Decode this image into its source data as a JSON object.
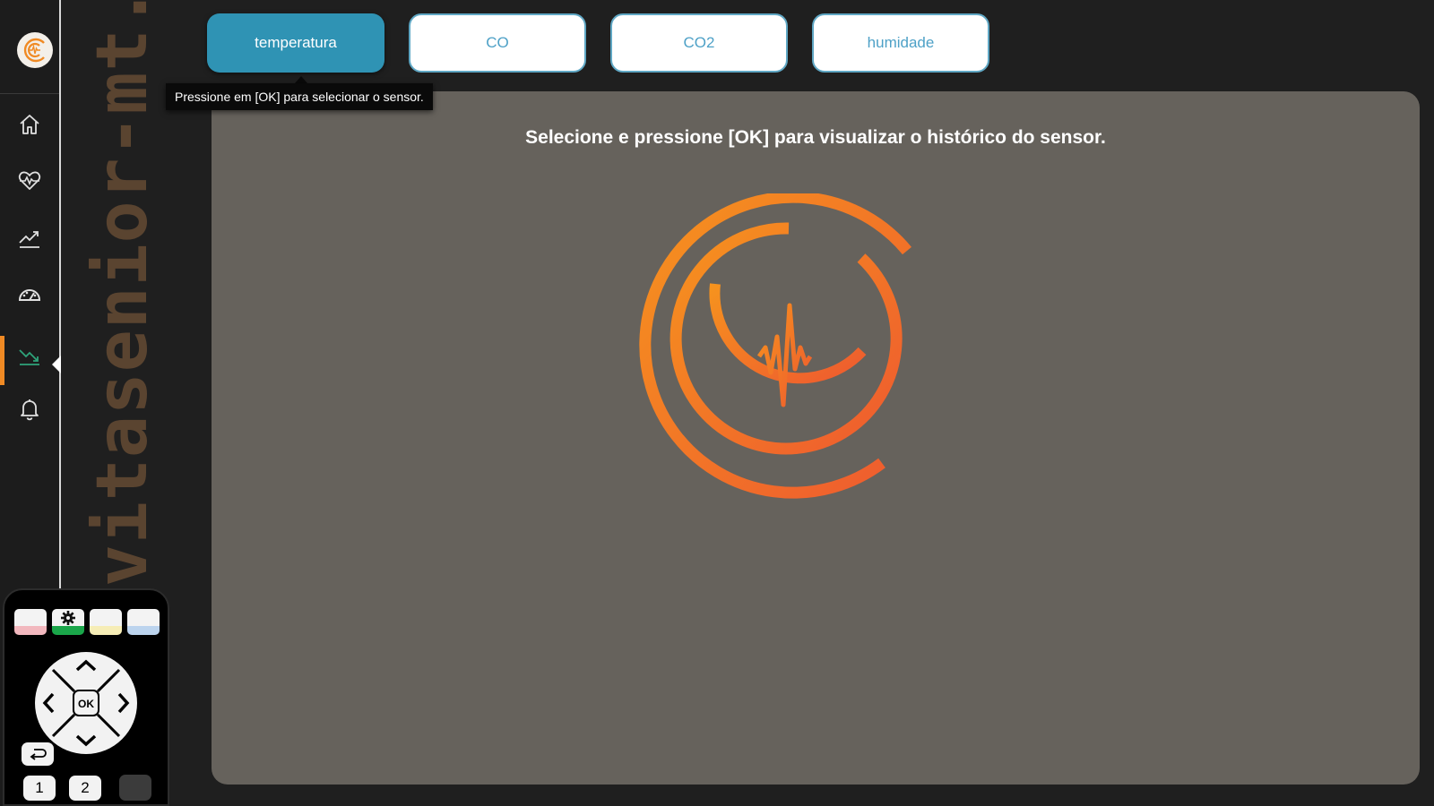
{
  "watermark": "vitasenior-mt.ipt",
  "tabs": [
    {
      "label": "temperatura",
      "active": true
    },
    {
      "label": "CO",
      "active": false
    },
    {
      "label": "CO2",
      "active": false
    },
    {
      "label": "humidade",
      "active": false
    }
  ],
  "tooltip": "Pressione em [OK] para selecionar o sensor.",
  "panel": {
    "message": "Selecione e pressione [OK] para visualizar o histórico do sensor."
  },
  "sidebar": {
    "items": [
      {
        "icon": "home-icon"
      },
      {
        "icon": "heart-monitor-icon"
      },
      {
        "icon": "trending-up-icon"
      },
      {
        "icon": "dashboard-gauge-icon"
      },
      {
        "icon": "trending-down-icon",
        "active": true
      },
      {
        "icon": "bell-icon"
      }
    ]
  },
  "remote": {
    "ok_label": "OK",
    "num1": "1",
    "num2": "2",
    "color_buttons": [
      "red",
      "green-settings",
      "yellow",
      "blue"
    ]
  },
  "colors": {
    "accent_orange": "#f08a24",
    "tab_active": "#2f93b4",
    "tab_text": "#4ea1c7",
    "panel_bg": "#66625c",
    "watermark": "#5a4430"
  }
}
